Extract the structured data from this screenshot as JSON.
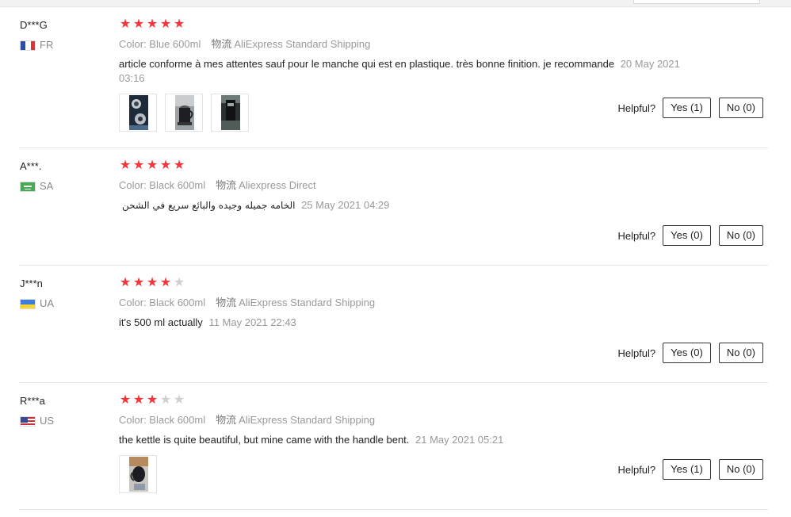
{
  "helpful_label": "Helpful?",
  "reviews": [
    {
      "user": "D***G",
      "country": "FR",
      "rating": 5,
      "color": "Color: Blue 600ml",
      "shipping_label": "物流",
      "shipping": "AliExpress Standard Shipping",
      "text": "article conforme à mes attentes sauf pour le manche qui est en plastique. très bonne finition. je recommande",
      "date": "20 May 2021 03:16",
      "photos": 3,
      "yes": "Yes (1)",
      "no": "No (0)"
    },
    {
      "user": "A***.",
      "country": "SA",
      "rating": 5,
      "color": "Color: Black 600ml",
      "shipping_label": "物流",
      "shipping": "Aliexpress Direct",
      "text": "الخامه جميله وجيده والبائع سريع في الشحن",
      "date": "25 May 2021 04:29",
      "photos": 0,
      "yes": "Yes (0)",
      "no": "No (0)"
    },
    {
      "user": "J***n",
      "country": "UA",
      "rating": 4,
      "color": "Color: Black 600ml",
      "shipping_label": "物流",
      "shipping": "AliExpress Standard Shipping",
      "text": "it's 500 ml actually",
      "date": "11 May 2021 22:43",
      "photos": 0,
      "yes": "Yes (0)",
      "no": "No (0)"
    },
    {
      "user": "R***a",
      "country": "US",
      "rating": 3,
      "color": "Color: Black 600ml",
      "shipping_label": "物流",
      "shipping": "AliExpress Standard Shipping",
      "text": "the kettle is quite beautiful, but mine came with the handle bent.",
      "date": "21 May 2021 05:21",
      "photos": 1,
      "yes": "Yes (1)",
      "no": "No (0)"
    }
  ]
}
